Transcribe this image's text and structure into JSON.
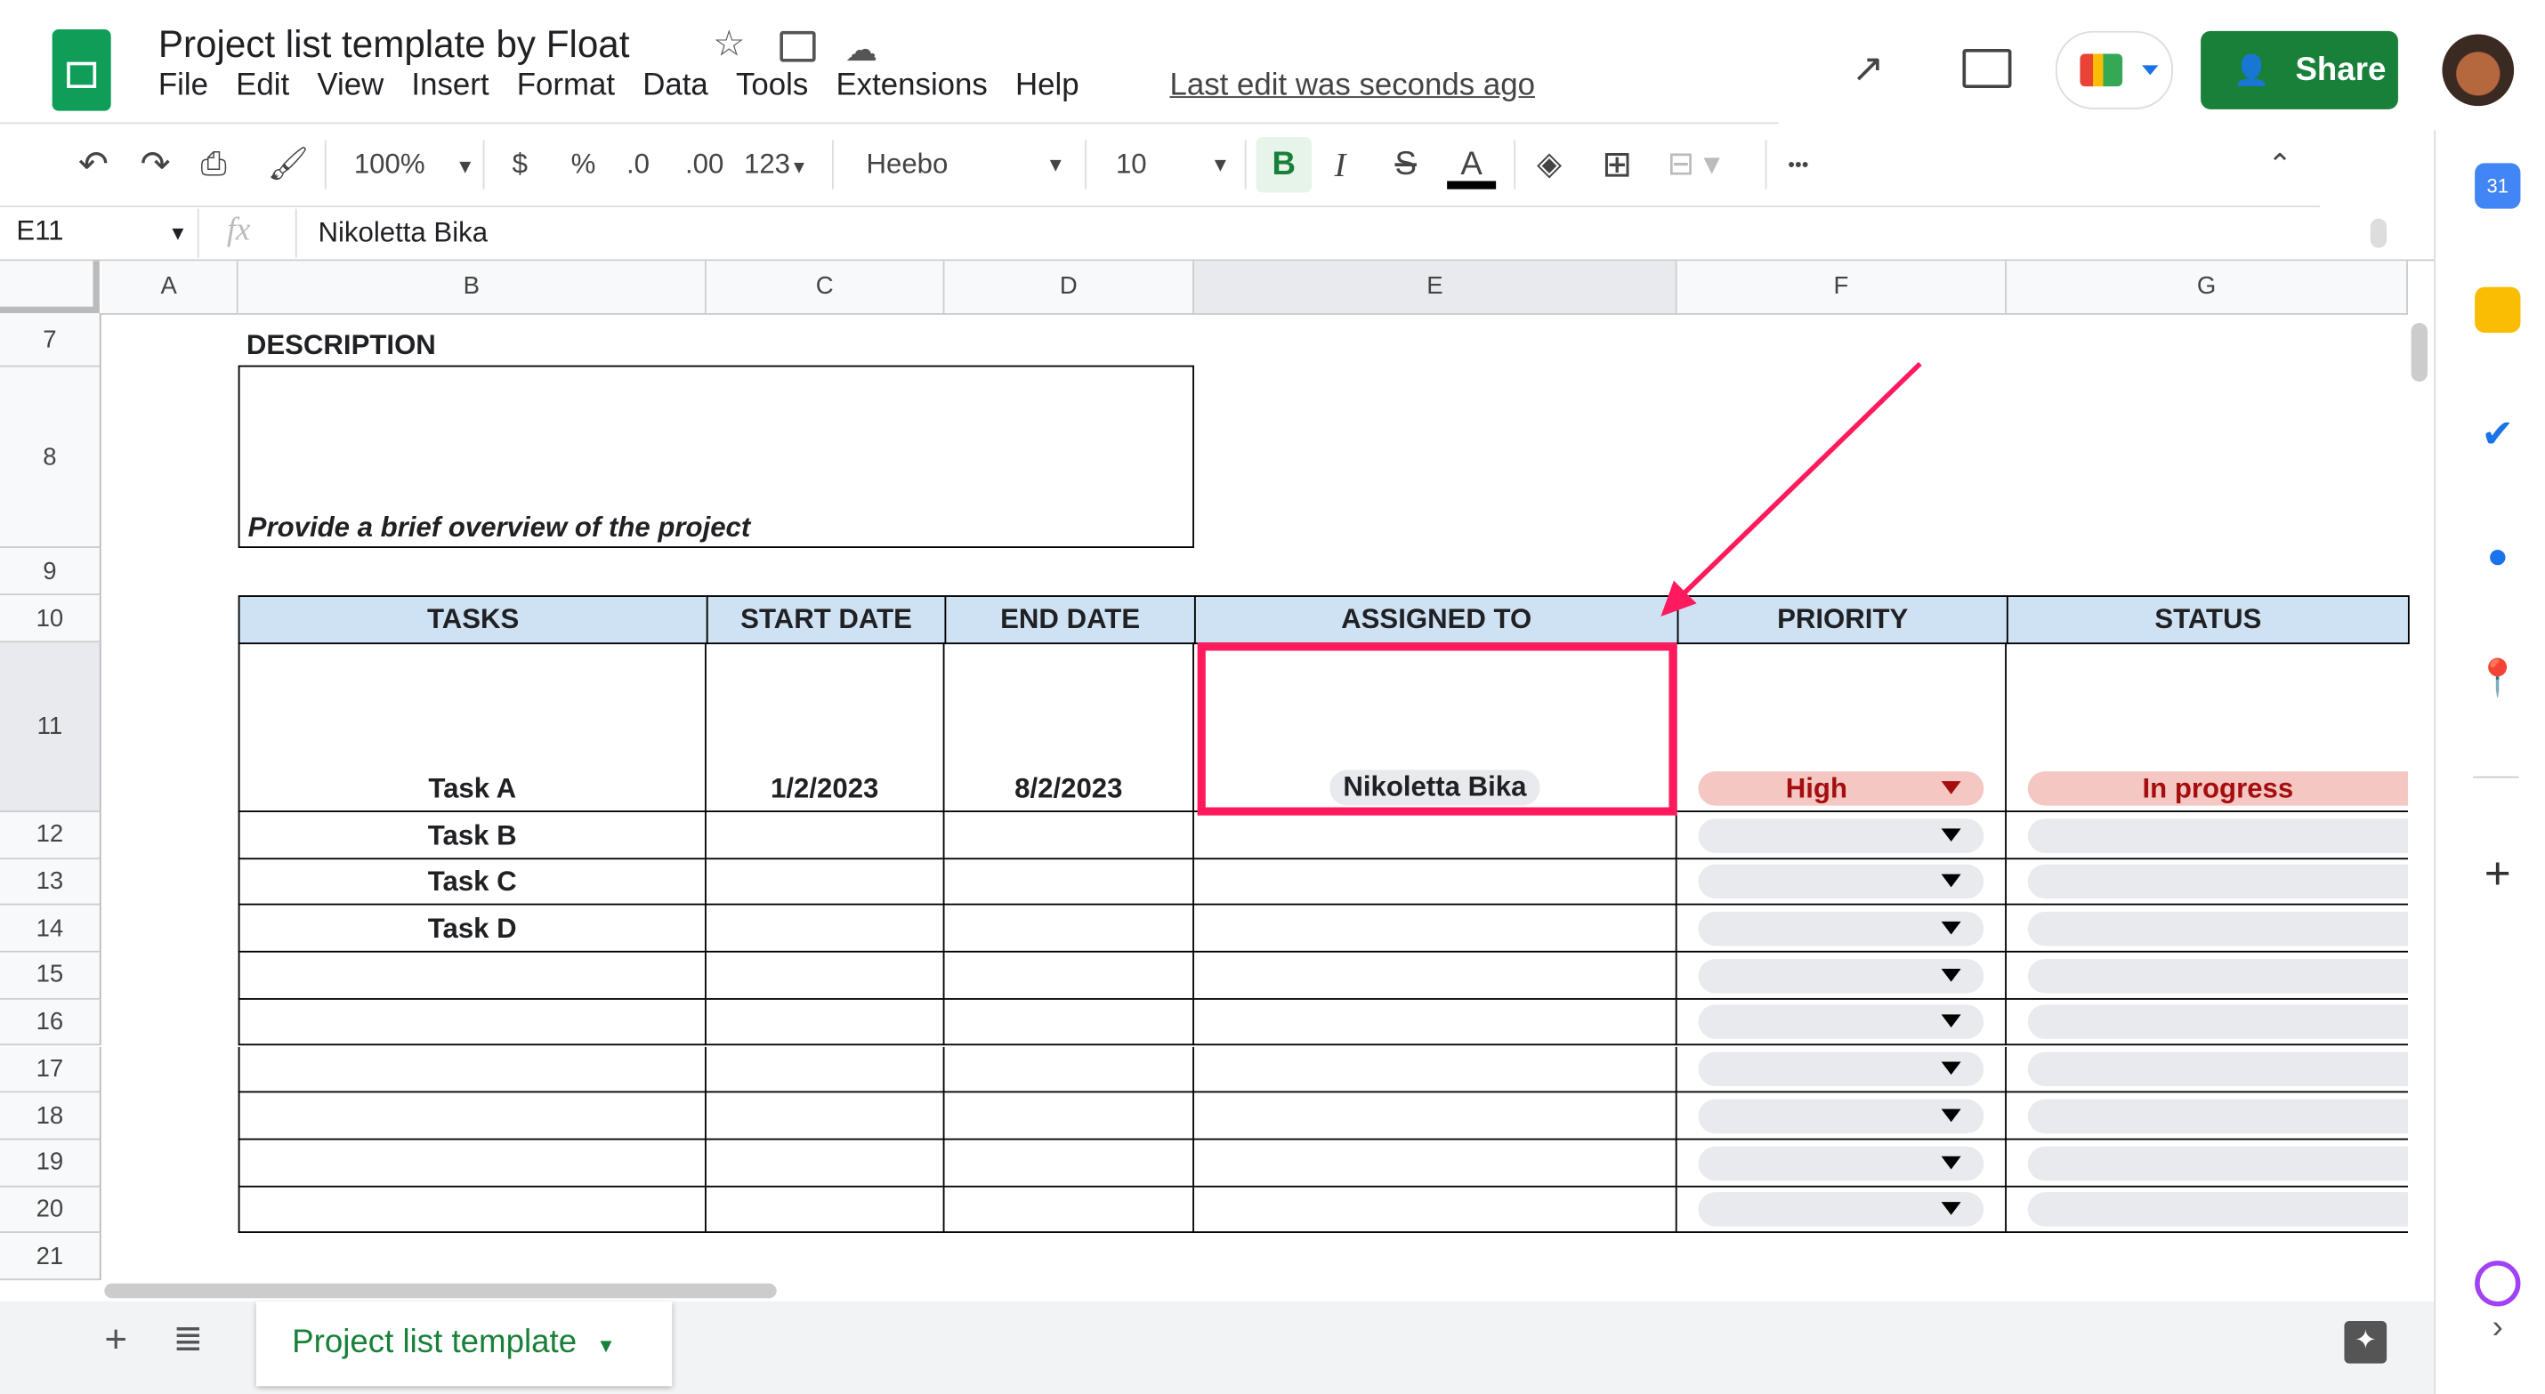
{
  "doc": {
    "title": "Project list template by Float",
    "last_edit": "Last edit was seconds ago"
  },
  "menu": [
    "File",
    "Edit",
    "View",
    "Insert",
    "Format",
    "Data",
    "Tools",
    "Extensions",
    "Help"
  ],
  "share_label": "Share",
  "toolbar": {
    "zoom": "100%",
    "currency": "$",
    "percent": "%",
    "dec_less": ".0",
    "dec_more": ".00",
    "format_more": "123",
    "font": "Heebo",
    "font_size": "10",
    "bold": "B",
    "italic": "I",
    "strike": "S",
    "text_color": "A",
    "more": "•••"
  },
  "formula": {
    "cell_ref": "E11",
    "fx": "fx",
    "value": "Nikoletta Bika"
  },
  "columns": [
    "A",
    "B",
    "C",
    "D",
    "E",
    "F",
    "G"
  ],
  "rows": [
    "7",
    "8",
    "9",
    "10",
    "11",
    "12",
    "13",
    "14",
    "15",
    "16",
    "17",
    "18",
    "19",
    "20",
    "21"
  ],
  "sheet": {
    "description_label": "DESCRIPTION",
    "description_hint": "Provide a brief overview of the project",
    "headers": [
      "TASKS",
      "START DATE",
      "END DATE",
      "ASSIGNED TO",
      "PRIORITY",
      "STATUS"
    ],
    "tasks": [
      {
        "task": "Task A",
        "start": "1/2/2023",
        "end": "8/2/2023",
        "assigned": "Nikoletta Bika",
        "priority": "High",
        "status": "In progress"
      },
      {
        "task": "Task B"
      },
      {
        "task": "Task C"
      },
      {
        "task": "Task D"
      },
      {},
      {},
      {},
      {},
      {},
      {}
    ]
  },
  "sheet_tab": "Project list template",
  "colors": {
    "accent": "#188038",
    "highlight_box": "#ff1a5e",
    "header_fill": "#cfe2f3",
    "high_pill": "#f4c7c3",
    "high_text": "#a50e0e"
  }
}
